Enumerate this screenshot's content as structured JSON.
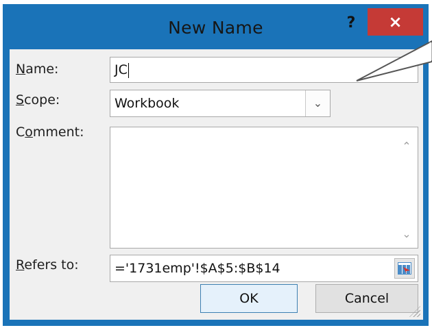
{
  "dialog": {
    "title": "New Name",
    "help_label": "?",
    "close_label": "×"
  },
  "form": {
    "name_label_accel": "N",
    "name_label_rest": "ame:",
    "name_value": "JC",
    "scope_label_accel": "S",
    "scope_label_rest": "cope:",
    "scope_value": "Workbook",
    "comment_label_pre": "C",
    "comment_label_accel": "o",
    "comment_label_rest": "mment:",
    "comment_value": "",
    "refers_label_accel": "R",
    "refers_label_rest": "efers to:",
    "refers_value": "='1731emp'!$A$5:$B$14"
  },
  "buttons": {
    "ok_label": "OK",
    "cancel_label": "Cancel"
  },
  "icons": {
    "dropdown": "chevron-down-icon",
    "scroll_up": "chevron-up-icon",
    "scroll_down": "chevron-down-icon",
    "range": "range-select-icon",
    "grip": "resize-grip-icon"
  },
  "colors": {
    "titlebar": "#1a73b8",
    "close_button": "#c53a36",
    "client_bg": "#f0f0f0"
  }
}
